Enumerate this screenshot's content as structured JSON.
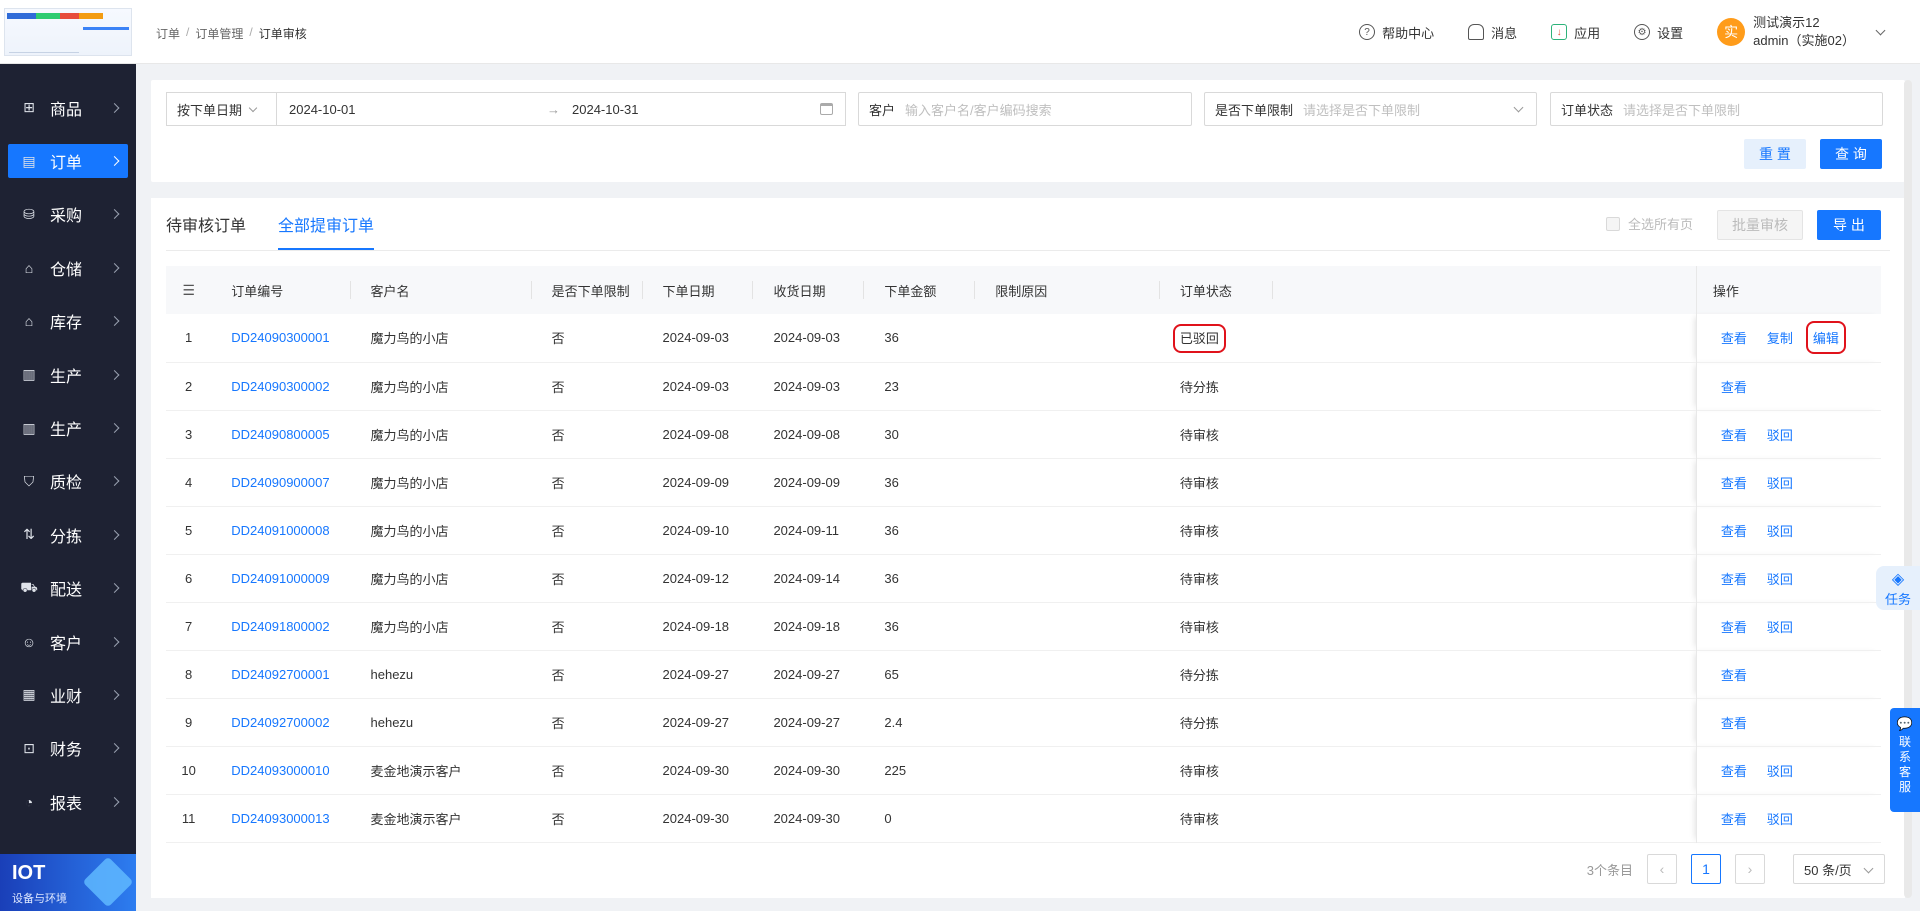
{
  "sidebar": {
    "items": [
      {
        "label": "商品",
        "icon": "grid-icon",
        "glyph": "⊞"
      },
      {
        "label": "订单",
        "icon": "clipboard-icon",
        "glyph": "▤",
        "active": true
      },
      {
        "label": "采购",
        "icon": "bag-icon",
        "glyph": "⛁"
      },
      {
        "label": "仓储",
        "icon": "warehouse-icon",
        "glyph": "⌂"
      },
      {
        "label": "库存",
        "icon": "inventory-icon",
        "glyph": "⌂"
      },
      {
        "label": "生产",
        "icon": "factory-icon",
        "glyph": "▥"
      },
      {
        "label": "生产",
        "icon": "factory-icon",
        "glyph": "▥"
      },
      {
        "label": "质检",
        "icon": "shield-icon",
        "glyph": "⛉"
      },
      {
        "label": "分拣",
        "icon": "sort-icon",
        "glyph": "⇅"
      },
      {
        "label": "配送",
        "icon": "truck-icon",
        "glyph": "⛟"
      },
      {
        "label": "客户",
        "icon": "user-icon",
        "glyph": "☺"
      },
      {
        "label": "业财",
        "icon": "chart-icon",
        "glyph": "▦"
      },
      {
        "label": "财务",
        "icon": "finance-icon",
        "glyph": "⊡"
      },
      {
        "label": "报表",
        "icon": "clock-icon",
        "glyph": "◔"
      }
    ],
    "banner": {
      "title": "IOT",
      "subtitle": "设备与环境"
    }
  },
  "header": {
    "breadcrumb": [
      "订单",
      "订单管理",
      "订单审核"
    ],
    "actions": {
      "help": "帮助中心",
      "messages": "消息",
      "apps": "应用",
      "settings": "设置"
    },
    "user": {
      "avatar": "实",
      "name": "测试演示12",
      "account": "admin（实施02）"
    }
  },
  "filters": {
    "date_type": "按下单日期",
    "date_start": "2024-10-01",
    "date_arrow": "→",
    "date_end": "2024-10-31",
    "customer_label": "客户",
    "customer_placeholder": "输入客户名/客户编码搜索",
    "limit_label": "是否下单限制",
    "limit_placeholder": "请选择是否下单限制",
    "status_label": "订单状态",
    "status_placeholder": "请选择是否下单限制",
    "reset": "重 置",
    "query": "查 询"
  },
  "tabs": [
    "待审核订单",
    "全部提审订单"
  ],
  "toolbar": {
    "select_all": "全选所有页",
    "batch_review": "批量审核",
    "export": "导 出"
  },
  "table": {
    "headers": [
      "订单编号",
      "客户名",
      "是否下单限制",
      "下单日期",
      "收货日期",
      "下单金额",
      "限制原因",
      "订单状态",
      "操作"
    ],
    "rows": [
      {
        "idx": "1",
        "order_no": "DD24090300001",
        "customer": "魔力鸟的小店",
        "limited": "否",
        "order_date": "2024-09-03",
        "delivery_date": "2024-09-03",
        "amount": "36",
        "reason": "",
        "status": "已驳回",
        "ops": [
          "查看",
          "复制",
          "编辑"
        ]
      },
      {
        "idx": "2",
        "order_no": "DD24090300002",
        "customer": "魔力鸟的小店",
        "limited": "否",
        "order_date": "2024-09-03",
        "delivery_date": "2024-09-03",
        "amount": "23",
        "reason": "",
        "status": "待分拣",
        "ops": [
          "查看"
        ]
      },
      {
        "idx": "3",
        "order_no": "DD24090800005",
        "customer": "魔力鸟的小店",
        "limited": "否",
        "order_date": "2024-09-08",
        "delivery_date": "2024-09-08",
        "amount": "30",
        "reason": "",
        "status": "待审核",
        "ops": [
          "查看",
          "驳回"
        ]
      },
      {
        "idx": "4",
        "order_no": "DD24090900007",
        "customer": "魔力鸟的小店",
        "limited": "否",
        "order_date": "2024-09-09",
        "delivery_date": "2024-09-09",
        "amount": "36",
        "reason": "",
        "status": "待审核",
        "ops": [
          "查看",
          "驳回"
        ]
      },
      {
        "idx": "5",
        "order_no": "DD24091000008",
        "customer": "魔力鸟的小店",
        "limited": "否",
        "order_date": "2024-09-10",
        "delivery_date": "2024-09-11",
        "amount": "36",
        "reason": "",
        "status": "待审核",
        "ops": [
          "查看",
          "驳回"
        ]
      },
      {
        "idx": "6",
        "order_no": "DD24091000009",
        "customer": "魔力鸟的小店",
        "limited": "否",
        "order_date": "2024-09-12",
        "delivery_date": "2024-09-14",
        "amount": "36",
        "reason": "",
        "status": "待审核",
        "ops": [
          "查看",
          "驳回"
        ]
      },
      {
        "idx": "7",
        "order_no": "DD24091800002",
        "customer": "魔力鸟的小店",
        "limited": "否",
        "order_date": "2024-09-18",
        "delivery_date": "2024-09-18",
        "amount": "36",
        "reason": "",
        "status": "待审核",
        "ops": [
          "查看",
          "驳回"
        ]
      },
      {
        "idx": "8",
        "order_no": "DD24092700001",
        "customer": "hehezu",
        "limited": "否",
        "order_date": "2024-09-27",
        "delivery_date": "2024-09-27",
        "amount": "65",
        "reason": "",
        "status": "待分拣",
        "ops": [
          "查看"
        ]
      },
      {
        "idx": "9",
        "order_no": "DD24092700002",
        "customer": "hehezu",
        "limited": "否",
        "order_date": "2024-09-27",
        "delivery_date": "2024-09-27",
        "amount": "2.4",
        "reason": "",
        "status": "待分拣",
        "ops": [
          "查看"
        ]
      },
      {
        "idx": "10",
        "order_no": "DD24093000010",
        "customer": "麦金地演示客户",
        "limited": "否",
        "order_date": "2024-09-30",
        "delivery_date": "2024-09-30",
        "amount": "225",
        "reason": "",
        "status": "待审核",
        "ops": [
          "查看",
          "驳回"
        ]
      },
      {
        "idx": "11",
        "order_no": "DD24093000013",
        "customer": "麦金地演示客户",
        "limited": "否",
        "order_date": "2024-09-30",
        "delivery_date": "2024-09-30",
        "amount": "0",
        "reason": "",
        "status": "待审核",
        "ops": [
          "查看",
          "驳回"
        ]
      }
    ]
  },
  "pager": {
    "total": "3个条目",
    "prev": "‹",
    "page": "1",
    "next": "›",
    "size": "50 条/页"
  },
  "floats": {
    "task": "任务",
    "service": [
      "联",
      "系",
      "客",
      "服"
    ]
  },
  "colors": {
    "primary": "#1677ff",
    "sidebar": "#1e2233",
    "highlight": "#e0121b",
    "avatar": "#ff9c1a"
  }
}
